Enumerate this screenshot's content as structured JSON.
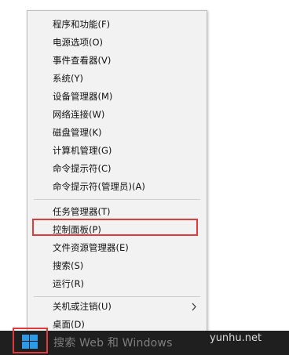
{
  "menu": {
    "items": [
      {
        "label": "程序和功能(F)"
      },
      {
        "label": "电源选项(O)"
      },
      {
        "label": "事件查看器(V)"
      },
      {
        "label": "系统(Y)"
      },
      {
        "label": "设备管理器(M)"
      },
      {
        "label": "网络连接(W)"
      },
      {
        "label": "磁盘管理(K)"
      },
      {
        "label": "计算机管理(G)"
      },
      {
        "label": "命令提示符(C)"
      },
      {
        "label": "命令提示符(管理员)(A)"
      },
      {
        "label": "任务管理器(T)"
      },
      {
        "label": "控制面板(P)"
      },
      {
        "label": "文件资源管理器(E)"
      },
      {
        "label": "搜索(S)"
      },
      {
        "label": "运行(R)"
      },
      {
        "label": "关机或注销(U)"
      },
      {
        "label": "桌面(D)"
      }
    ],
    "submenu_arrow_icon": "chevron-right-icon"
  },
  "taskbar": {
    "search_text": "搜索 Web 和 Windows",
    "start_icon": "windows-logo-icon"
  },
  "watermark": "yunhu.net",
  "colors": {
    "highlight_border": "#e23a3a",
    "menu_bg": "#f2f2f2",
    "taskbar_bg": "#1f1f1f"
  }
}
